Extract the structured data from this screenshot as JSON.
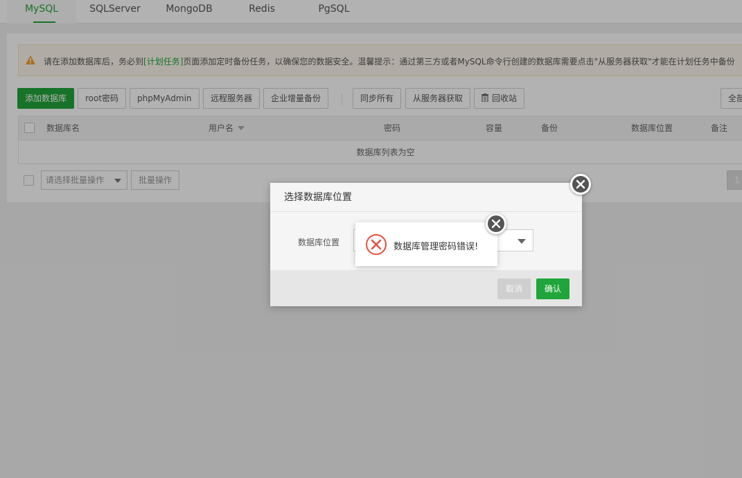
{
  "tabs": [
    {
      "label": "MySQL",
      "active": true
    },
    {
      "label": "SQLServer"
    },
    {
      "label": "MongoDB"
    },
    {
      "label": "Redis"
    },
    {
      "label": "PgSQL"
    }
  ],
  "notice": {
    "icon": "warning-icon",
    "text_before": "请在添加数据库后，务必到",
    "link": "[计划任务]",
    "text_after": "页面添加定时备份任务，以确保您的数据安全。温馨提示：通过第三方或者MySQL命令行创建的数据库需要点击\"从服务器获取\"才能在计划任务中备份"
  },
  "toolbar": {
    "add_db": "添加数据库",
    "root_pw": "root密码",
    "phpmyadmin": "phpMyAdmin",
    "remote": "远程服务器",
    "enterprise_backup": "企业增量备份",
    "sync_all": "同步所有",
    "fetch_from_server": "从服务器获取",
    "recycle": "回收站",
    "right_partial": "全部"
  },
  "table": {
    "columns": [
      "数据库名",
      "用户名",
      "密码",
      "容量",
      "备份",
      "数据库位置",
      "备注"
    ],
    "empty_text": "数据库列表为空"
  },
  "footer": {
    "batch_placeholder": "请选择批量操作",
    "batch_button": "批量操作",
    "page": "1"
  },
  "dialog": {
    "title": "选择数据库位置",
    "field_label": "数据库位置",
    "cancel": "取消",
    "confirm": "确认"
  },
  "toast": {
    "icon": "error-circle-icon",
    "message": "数据库管理密码错误!"
  },
  "colors": {
    "accent": "#20a53a",
    "error": "#e64c3c",
    "warning": "#f0a030"
  }
}
